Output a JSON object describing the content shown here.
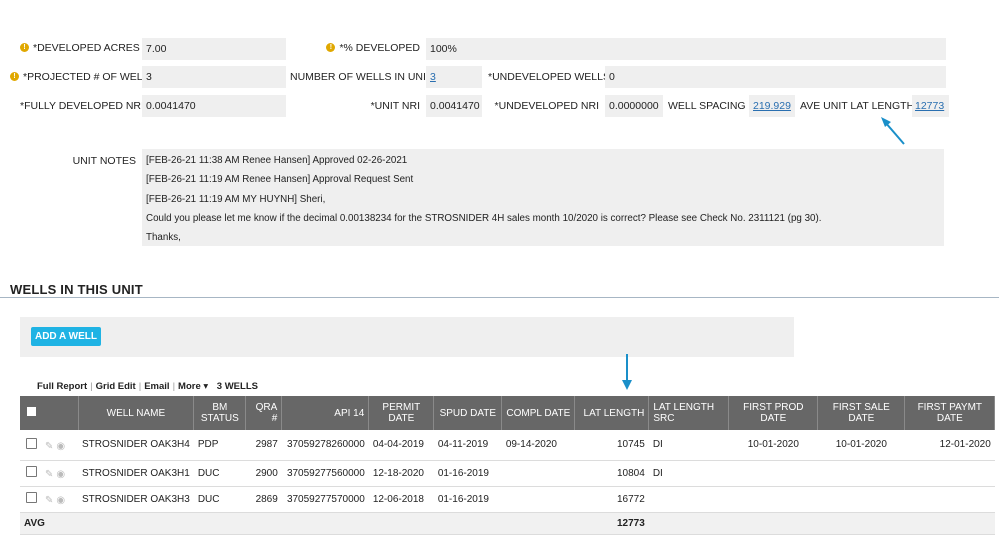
{
  "fields": {
    "developed_acres": {
      "label": "*DEVELOPED ACRES",
      "value": "7.00"
    },
    "pct_developed": {
      "label": "*% DEVELOPED",
      "value": "100%"
    },
    "projected_wells": {
      "label": "*PROJECTED # OF WELLS",
      "value": "3"
    },
    "wells_in_unit": {
      "label": "NUMBER OF WELLS IN UNIT",
      "value": "3"
    },
    "undeveloped_wells": {
      "label": "*UNDEVELOPED WELLS",
      "value": "0"
    },
    "fully_developed_nri": {
      "label": "*FULLY DEVELOPED NRI",
      "value": "0.0041470"
    },
    "unit_nri": {
      "label": "*UNIT NRI",
      "value": "0.0041470"
    },
    "undeveloped_nri": {
      "label": "*UNDEVELOPED NRI",
      "value": "0.0000000"
    },
    "well_spacing": {
      "label": "WELL SPACING",
      "value": "219.929"
    },
    "ave_lat_length": {
      "label": "AVE UNIT LAT LENGTH",
      "value": "12773"
    }
  },
  "unit_notes": {
    "label": "UNIT NOTES",
    "lines": [
      "[FEB-26-21 11:38 AM  Renee Hansen] Approved 02-26-2021",
      "[FEB-26-21 11:19 AM  Renee Hansen] Approval Request Sent",
      "[FEB-26-21 11:19 AM  MY HUYNH] Sheri,",
      "Could you please let me know if the decimal 0.00138234  for the STROSNIDER 4H sales month 10/2020 is correct?  Please see Check No. 2311121 (pg 30).",
      "Thanks,"
    ]
  },
  "section": {
    "title": "WELLS IN THIS UNIT"
  },
  "add_well": {
    "label": "ADD A WELL"
  },
  "toolbar": {
    "full_report": "Full Report",
    "grid_edit": "Grid Edit",
    "email": "Email",
    "more": "More",
    "count": "3 WELLS"
  },
  "columns": [
    "WELL NAME",
    "BM STATUS",
    "QRA #",
    "API 14",
    "PERMIT DATE",
    "SPUD DATE",
    "COMPL DATE",
    "LAT LENGTH",
    "LAT LENGTH SRC",
    "FIRST PROD DATE",
    "FIRST SALE DATE",
    "FIRST PAYMT DATE"
  ],
  "rows": [
    {
      "well_name": "STROSNIDER OAK3H4",
      "bm_status": "PDP",
      "qra": "2987",
      "api14": "37059278260000",
      "permit": "04-04-2019",
      "spud": "04-11-2019",
      "compl": "09-14-2020",
      "lat_length": "10745",
      "lat_src": "DI",
      "first_prod": "10-01-2020",
      "first_sale": "10-01-2020",
      "first_paymt": "12-01-2020"
    },
    {
      "well_name": "STROSNIDER OAK3H1",
      "bm_status": "DUC",
      "qra": "2900",
      "api14": "37059277560000",
      "permit": "12-18-2020",
      "spud": "01-16-2019",
      "compl": "",
      "lat_length": "10804",
      "lat_src": "DI",
      "first_prod": "",
      "first_sale": "",
      "first_paymt": ""
    },
    {
      "well_name": "STROSNIDER OAK3H3",
      "bm_status": "DUC",
      "qra": "2869",
      "api14": "37059277570000",
      "permit": "12-06-2018",
      "spud": "01-16-2019",
      "compl": "",
      "lat_length": "16772",
      "lat_src": "",
      "first_prod": "",
      "first_sale": "",
      "first_paymt": ""
    }
  ],
  "avg_row": {
    "label": "AVG",
    "lat_length": "12773"
  },
  "colors": {
    "arrow": "#1a8fc9",
    "header_bg": "#676767",
    "button": "#1fb3e4",
    "link": "#2a6fb0"
  }
}
